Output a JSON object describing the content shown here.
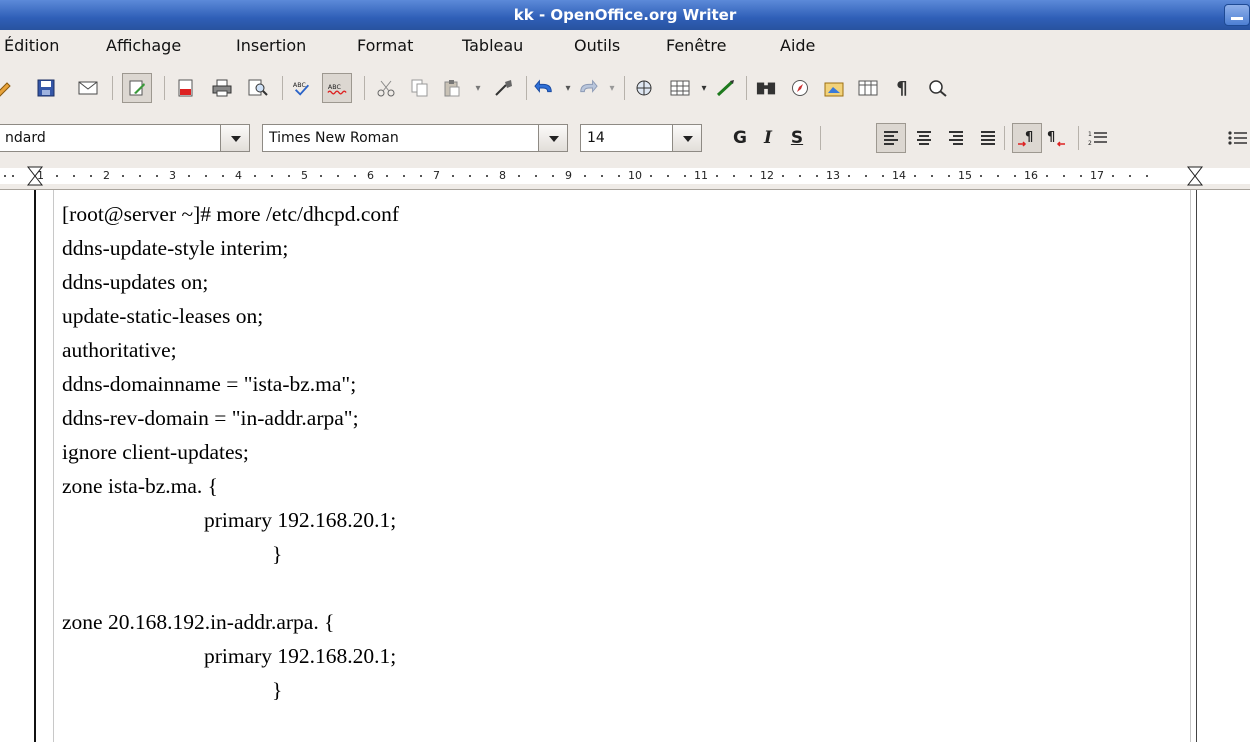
{
  "window": {
    "title": "kk - OpenOffice.org Writer"
  },
  "menubar": {
    "items": [
      "Édition",
      "Affichage",
      "Insertion",
      "Format",
      "Tableau",
      "Outils",
      "Fenêtre",
      "Aide"
    ]
  },
  "toolbar": {
    "icons": [
      "edit-file-icon",
      "save-icon",
      "email-icon",
      "edit-mode-icon",
      "export-pdf-icon",
      "print-icon",
      "page-preview-icon",
      "spellcheck-icon",
      "autospellcheck-icon",
      "cut-icon",
      "copy-icon",
      "paste-icon",
      "clone-format-icon",
      "undo-icon",
      "redo-icon",
      "hyperlink-icon",
      "table-icon",
      "draw-functions-icon",
      "find-replace-icon",
      "navigator-icon",
      "gallery-icon",
      "data-sources-icon",
      "formatting-marks-icon",
      "zoom-icon"
    ]
  },
  "formatting": {
    "paragraph_style": "ndard",
    "font_name": "Times New Roman",
    "font_size": "14",
    "bold_label": "G",
    "italic_label": "I",
    "underline_label": "S"
  },
  "ruler": {
    "numbers": [
      "1",
      "2",
      "3",
      "4",
      "5",
      "6",
      "7",
      "8",
      "9",
      "10",
      "11",
      "12",
      "13",
      "14",
      "15",
      "16",
      "17"
    ]
  },
  "document": {
    "lines": [
      "[root@server ~]# more /etc/dhcpd.conf",
      "ddns-update-style interim;",
      "ddns-updates on;",
      "update-static-leases on;",
      "authoritative;",
      "ddns-domainname = \"ista-bz.ma\";",
      "ddns-rev-domain = \"in-addr.arpa\";",
      "ignore client-updates;",
      "zone ista-bz.ma. {",
      "primary 192.168.20.1;",
      "}",
      "",
      "zone 20.168.192.in-addr.arpa. {",
      "primary 192.168.20.1;",
      "}"
    ]
  }
}
